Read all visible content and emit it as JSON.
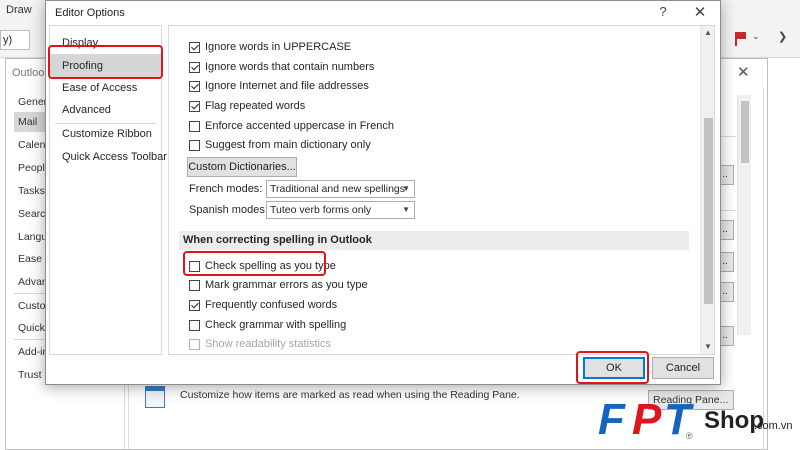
{
  "background": {
    "ribbon_tab": "Draw",
    "ribbon_combo": "y)",
    "outlook_options_title": "Outloo",
    "nav_items": [
      "Genera",
      "Mail",
      "Calend",
      "People",
      "Tasks",
      "Search",
      "Langu",
      "Ease o",
      "Advan",
      "Custor",
      "Quick",
      "Add-in",
      "Trust C"
    ],
    "selected_nav": "Mail",
    "reading_pane_text": "Customize how items are marked as read when using the Reading Pane.",
    "reading_pane_button": "Reading Pane...",
    "close_glyph": "✕"
  },
  "dialog": {
    "title": "Editor Options",
    "help_glyph": "?",
    "close_glyph": "✕",
    "nav": [
      {
        "label": "Display",
        "selected": false
      },
      {
        "label": "Proofing",
        "selected": true
      },
      {
        "label": "Ease of Access",
        "selected": false
      },
      {
        "label": "Advanced",
        "selected": false
      },
      {
        "label": "Customize Ribbon",
        "selected": false
      },
      {
        "label": "Quick Access Toolbar",
        "selected": false
      }
    ],
    "options_top": [
      {
        "label": "Ignore words in UPPERCASE",
        "checked": true
      },
      {
        "label": "Ignore words that contain numbers",
        "checked": true
      },
      {
        "label": "Ignore Internet and file addresses",
        "checked": true
      },
      {
        "label": "Flag repeated words",
        "checked": true
      },
      {
        "label": "Enforce accented uppercase in French",
        "checked": false
      },
      {
        "label": "Suggest from main dictionary only",
        "checked": false
      }
    ],
    "custom_dictionaries_button": "Custom Dictionaries...",
    "french_modes": {
      "label": "French modes:",
      "value": "Traditional and new spellings"
    },
    "spanish_modes": {
      "label": "Spanish modes:",
      "value": "Tuteo verb forms only"
    },
    "section_heading": "When correcting spelling in Outlook",
    "options_bottom": [
      {
        "label": "Check spelling as you type",
        "checked": false,
        "disabled": false
      },
      {
        "label": "Mark grammar errors as you type",
        "checked": false,
        "disabled": false
      },
      {
        "label": "Frequently confused words",
        "checked": true,
        "disabled": false
      },
      {
        "label": "Check grammar with spelling",
        "checked": false,
        "disabled": false
      },
      {
        "label": "Show readability statistics",
        "checked": false,
        "disabled": true
      }
    ],
    "ok_label": "OK",
    "cancel_label": "Cancel"
  },
  "watermark": {
    "letters": [
      "F",
      "P",
      "T"
    ],
    "brand_word": "Shop",
    "domain": ".com.vn",
    "reg_mark": "®",
    "colors": {
      "blue": "#1565c0",
      "red": "#e0141e"
    }
  },
  "colors": {
    "highlight": "#e0141e",
    "accent": "#0078d7",
    "selected_nav": "#d6d6d6",
    "section_bg": "#ececec"
  }
}
